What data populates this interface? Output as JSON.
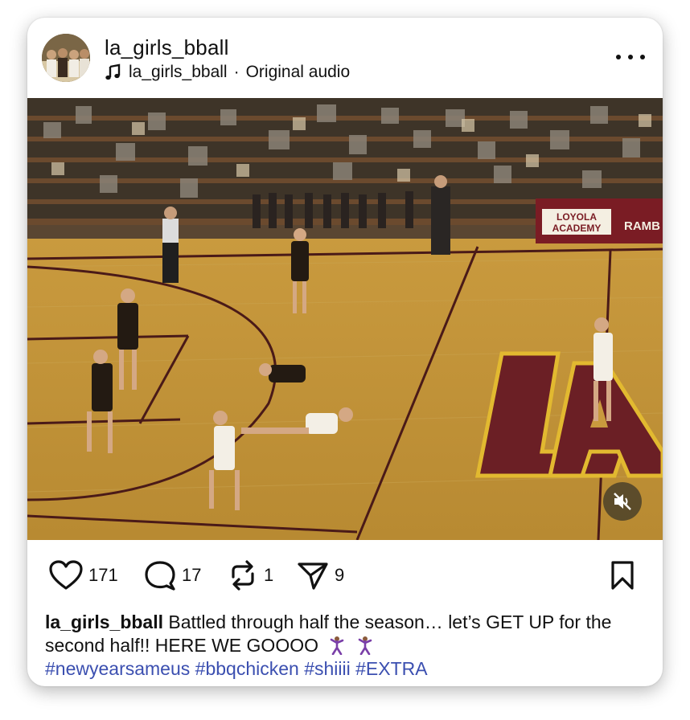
{
  "post": {
    "username": "la_girls_bball",
    "audio_owner": "la_girls_bball",
    "audio_separator": "·",
    "audio_label": "Original audio"
  },
  "media": {
    "banner_line1": "LOYOLA",
    "banner_line2": "ACADEMY",
    "banner_partial": "RAMB",
    "floor_logo": "LA"
  },
  "actions": {
    "likes": "171",
    "comments": "17",
    "reposts": "1",
    "shares": "9"
  },
  "caption": {
    "user": "la_girls_bball",
    "text": "Battled through half the season… let’s GET UP for the second half!! HERE WE GOOOO",
    "hashtags": "#newyearsameus #bbqchicken #shiiii #EXTRA"
  },
  "colors": {
    "hashtag": "#3b4fb0",
    "court_floor": "#c9a04a",
    "court_maroon": "#6b1f25",
    "court_gold": "#e2b930"
  },
  "icons": [
    "music-note-icon",
    "more-options-icon",
    "mute-icon",
    "heart-icon",
    "comment-icon",
    "repost-icon",
    "share-icon",
    "bookmark-icon",
    "dancer-emoji-icon"
  ]
}
